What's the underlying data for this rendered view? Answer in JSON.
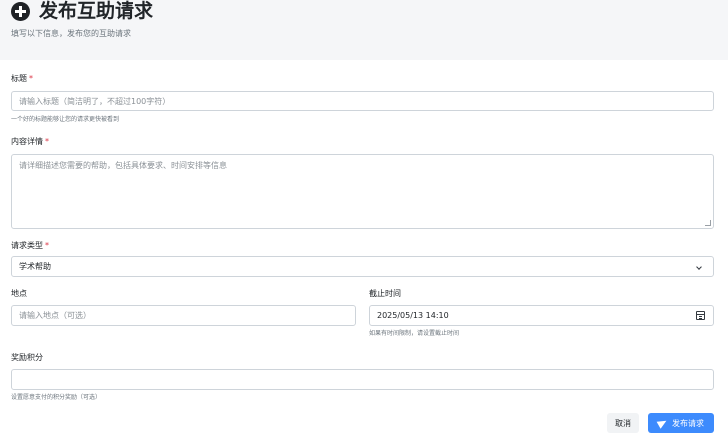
{
  "header": {
    "icon": "plus-circle-icon",
    "title": "发布互助请求",
    "subtitle": "填写以下信息，发布您的互助请求"
  },
  "form": {
    "title_field": {
      "label": "标题",
      "required_mark": "*",
      "value": "",
      "placeholder": "请输入标题（简洁明了，不超过100字符）",
      "help": "一个好的标题能够让您的请求更快被看到"
    },
    "content_field": {
      "label": "内容详情",
      "required_mark": "*",
      "value": "",
      "placeholder": "请详细描述您需要的帮助，包括具体要求、时间安排等信息"
    },
    "type_field": {
      "label": "请求类型",
      "required_mark": "*",
      "selected": "学术帮助"
    },
    "location_field": {
      "label": "地点",
      "value": "",
      "placeholder": "请输入地点（可选）"
    },
    "deadline_field": {
      "label": "截止时间",
      "value": "2025/05/13 14:10",
      "help": "如果有时间限制，请设置截止时间"
    },
    "reward_field": {
      "label": "奖励积分",
      "value": "",
      "help": "设置愿意支付的积分奖励（可选）"
    }
  },
  "actions": {
    "cancel_label": "取消",
    "submit_label": "发布请求",
    "submit_icon": "send-icon"
  },
  "colors": {
    "primary": "#3d8bfd",
    "required": "#dc3545",
    "header_bg": "#f5f6f8"
  }
}
